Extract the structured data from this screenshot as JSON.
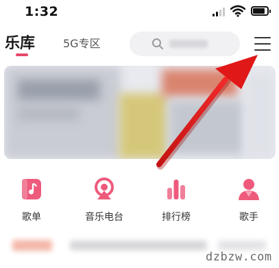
{
  "status_bar": {
    "time": "1:32"
  },
  "header": {
    "tab_active": "乐库",
    "tab_inactive": "5G专区",
    "search_placeholder": ""
  },
  "categories": [
    {
      "label": "歌单",
      "icon": "playlist-icon"
    },
    {
      "label": "音乐电台",
      "icon": "radio-icon"
    },
    {
      "label": "排行榜",
      "icon": "chart-bars-icon"
    },
    {
      "label": "歌手",
      "icon": "singer-icon"
    }
  ],
  "watermark": "dzbzw.com",
  "colors": {
    "accent": "#e8476b",
    "annotation_arrow": "#e01818"
  }
}
